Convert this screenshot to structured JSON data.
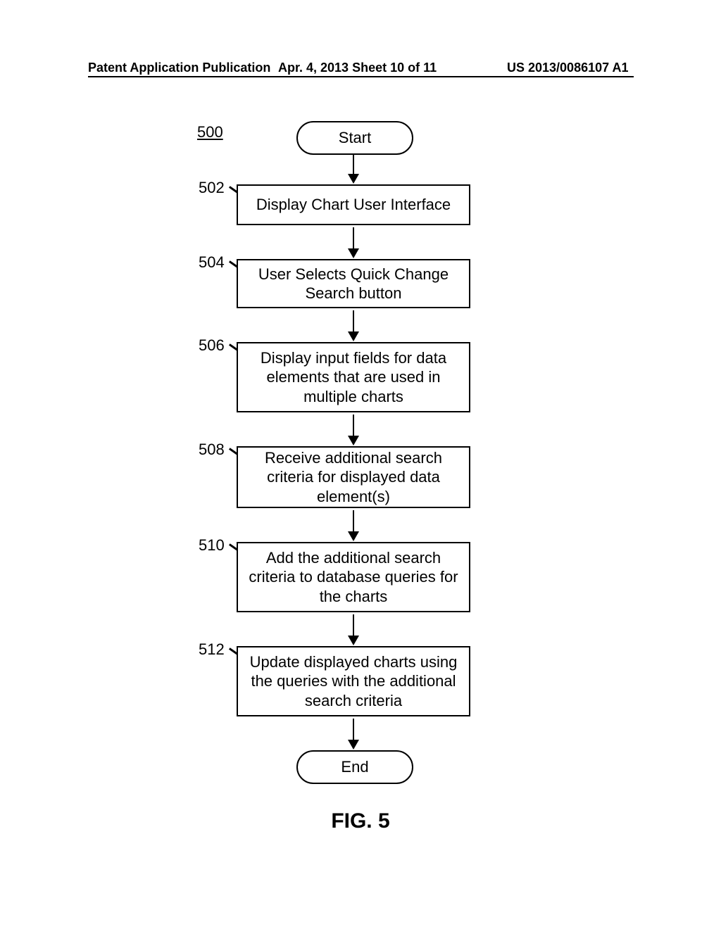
{
  "header": {
    "left": "Patent Application Publication",
    "center": "Apr. 4, 2013  Sheet 10 of 11",
    "right": "US 2013/0086107 A1"
  },
  "flowchart": {
    "figure_label": "FIG. 5",
    "ref_main": "500",
    "start": "Start",
    "end": "End",
    "steps": [
      {
        "ref": "502",
        "text": "Display Chart User Interface"
      },
      {
        "ref": "504",
        "text": "User Selects Quick Change Search button"
      },
      {
        "ref": "506",
        "text": "Display input fields for data elements that are used in multiple charts"
      },
      {
        "ref": "508",
        "text": "Receive additional search criteria for displayed data element(s)"
      },
      {
        "ref": "510",
        "text": "Add the additional  search criteria to database queries for the charts"
      },
      {
        "ref": "512",
        "text": "Update displayed charts using the queries with the additional search criteria"
      }
    ]
  }
}
